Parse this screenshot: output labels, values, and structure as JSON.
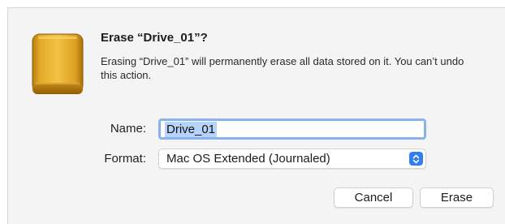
{
  "dialog": {
    "title": "Erase “Drive_01”?",
    "message": "Erasing “Drive_01” will permanently erase all data stored on it. You can’t undo this action.",
    "icon": "external-drive-icon"
  },
  "form": {
    "name_label": "Name:",
    "name_value": "Drive_01",
    "format_label": "Format:",
    "format_value": "Mac OS Extended (Journaled)"
  },
  "buttons": {
    "cancel": "Cancel",
    "erase": "Erase"
  },
  "colors": {
    "accent": "#2f7ef6",
    "selection": "#b5d3fb",
    "focus_ring": "#8ab2ec",
    "drive_gold": "#e0a21f"
  }
}
